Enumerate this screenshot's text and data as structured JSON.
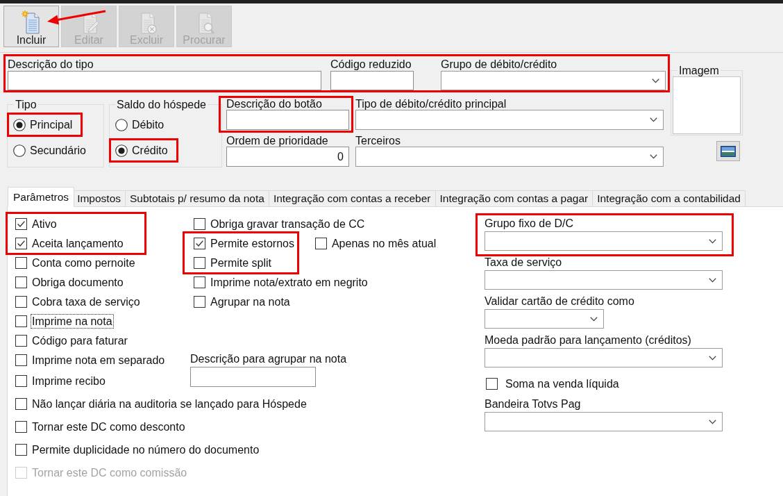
{
  "toolbar": {
    "buttons": [
      {
        "label": "Incluir",
        "disabled": false,
        "highlighted": true
      },
      {
        "label": "Editar",
        "disabled": true,
        "highlighted": false
      },
      {
        "label": "Excluir",
        "disabled": true,
        "highlighted": false
      },
      {
        "label": "Procurar",
        "disabled": true,
        "highlighted": false
      }
    ]
  },
  "header": {
    "highlighted": true,
    "fields": [
      {
        "label": "Descrição do tipo",
        "kind": "text"
      },
      {
        "label": "Código reduzido",
        "kind": "text"
      },
      {
        "label": "Grupo de débito/crédito",
        "kind": "select"
      }
    ]
  },
  "image": {
    "label": "Imagem"
  },
  "radio_groups": [
    {
      "label": "Tipo",
      "options": [
        {
          "label": "Principal",
          "selected": true,
          "highlighted": true
        },
        {
          "label": "Secundário",
          "selected": false,
          "highlighted": false
        }
      ]
    },
    {
      "label": "Saldo do hóspede",
      "options": [
        {
          "label": "Débito",
          "selected": false,
          "highlighted": false
        },
        {
          "label": "Crédito",
          "selected": true,
          "highlighted": true
        }
      ]
    }
  ],
  "fields": [
    {
      "label": "Descrição do botão",
      "kind": "text",
      "highlighted": true
    },
    {
      "label": "Tipo de débito/crédito principal",
      "kind": "select",
      "highlighted": false
    },
    {
      "label": "Ordem de prioridade",
      "kind": "number",
      "value": "0",
      "highlighted": false
    },
    {
      "label": "Terceiros",
      "kind": "select",
      "highlighted": false
    }
  ],
  "tabs": [
    {
      "label": "Parâmetros",
      "selected": true
    },
    {
      "label": "Impostos",
      "selected": false
    },
    {
      "label": "Subtotais p/ resumo da nota",
      "selected": false
    },
    {
      "label": "Integração com contas a receber",
      "selected": false
    },
    {
      "label": "Integração com contas a pagar",
      "selected": false
    },
    {
      "label": "Integração com a contabilidad",
      "selected": false
    }
  ],
  "tab_panel": {
    "column_1": [
      {
        "label": "Ativo",
        "checked": true,
        "highlighted": true,
        "focused": false,
        "disabled": false
      },
      {
        "label": "Aceita lançamento",
        "checked": true,
        "highlighted": true,
        "focused": false,
        "disabled": false
      },
      {
        "label": "Conta como pernoite",
        "checked": false,
        "highlighted": false,
        "focused": false,
        "disabled": false
      },
      {
        "label": "Obriga documento",
        "checked": false,
        "highlighted": false,
        "focused": false,
        "disabled": false
      },
      {
        "label": "Cobra taxa de serviço",
        "checked": false,
        "highlighted": false,
        "focused": false,
        "disabled": false
      },
      {
        "label": "Imprime na nota",
        "checked": false,
        "highlighted": false,
        "focused": true,
        "disabled": false
      },
      {
        "label": "Código para faturar",
        "checked": false,
        "highlighted": false,
        "focused": false,
        "disabled": false
      },
      {
        "label": "Imprime nota em separado",
        "checked": false,
        "highlighted": false,
        "focused": false,
        "disabled": false
      },
      {
        "label": "Imprime recibo",
        "checked": false,
        "highlighted": false,
        "focused": false,
        "disabled": false
      },
      {
        "label": "Não lançar diária na auditoria se lançado para Hóspede",
        "checked": false,
        "highlighted": false,
        "focused": false,
        "disabled": false
      },
      {
        "label": "Tornar este DC como desconto",
        "checked": false,
        "highlighted": false,
        "focused": false,
        "disabled": false
      },
      {
        "label": "Permite duplicidade no número do documento",
        "checked": false,
        "highlighted": false,
        "focused": false,
        "disabled": false
      },
      {
        "label": "Tornar este DC como comissão",
        "checked": false,
        "highlighted": false,
        "focused": false,
        "disabled": true
      }
    ],
    "column_2": [
      {
        "kind": "checkbox",
        "label": "Obriga gravar transação de CC",
        "checked": false,
        "highlighted": false,
        "focused": false,
        "disabled": false
      },
      {
        "kind": "checkbox",
        "label": "Permite estornos",
        "checked": true,
        "highlighted": true,
        "focused": false,
        "disabled": false,
        "beside": {
          "label": "Apenas no mês atual",
          "checked": false,
          "focused": false,
          "disabled": false
        }
      },
      {
        "kind": "checkbox",
        "label": "Permite split",
        "checked": false,
        "highlighted": true,
        "focused": false,
        "disabled": false
      },
      {
        "kind": "checkbox",
        "label": "Imprime nota/extrato em negrito",
        "checked": false,
        "highlighted": false,
        "focused": false,
        "disabled": false
      },
      {
        "kind": "checkbox",
        "label": "Agrupar na nota",
        "checked": false,
        "highlighted": false,
        "focused": false,
        "disabled": false
      },
      {
        "kind": "text_field",
        "label": "Descrição para agrupar na nota",
        "highlighted": false
      }
    ],
    "column_3": [
      {
        "kind": "select",
        "label": "Grupo fixo de D/C",
        "highlighted": true
      },
      {
        "kind": "select",
        "label": "Taxa de serviço",
        "highlighted": false
      },
      {
        "kind": "select",
        "label": "Validar cartão de crédito como",
        "highlighted": false
      },
      {
        "kind": "select",
        "label": "Moeda padrão para lançamento (créditos)",
        "highlighted": false
      },
      {
        "kind": "checkbox",
        "label": "Soma na venda líquida",
        "checked": false,
        "highlighted": false,
        "focused": false,
        "disabled": false
      },
      {
        "kind": "select",
        "label": "Bandeira Totvs Pag",
        "highlighted": false
      }
    ]
  }
}
